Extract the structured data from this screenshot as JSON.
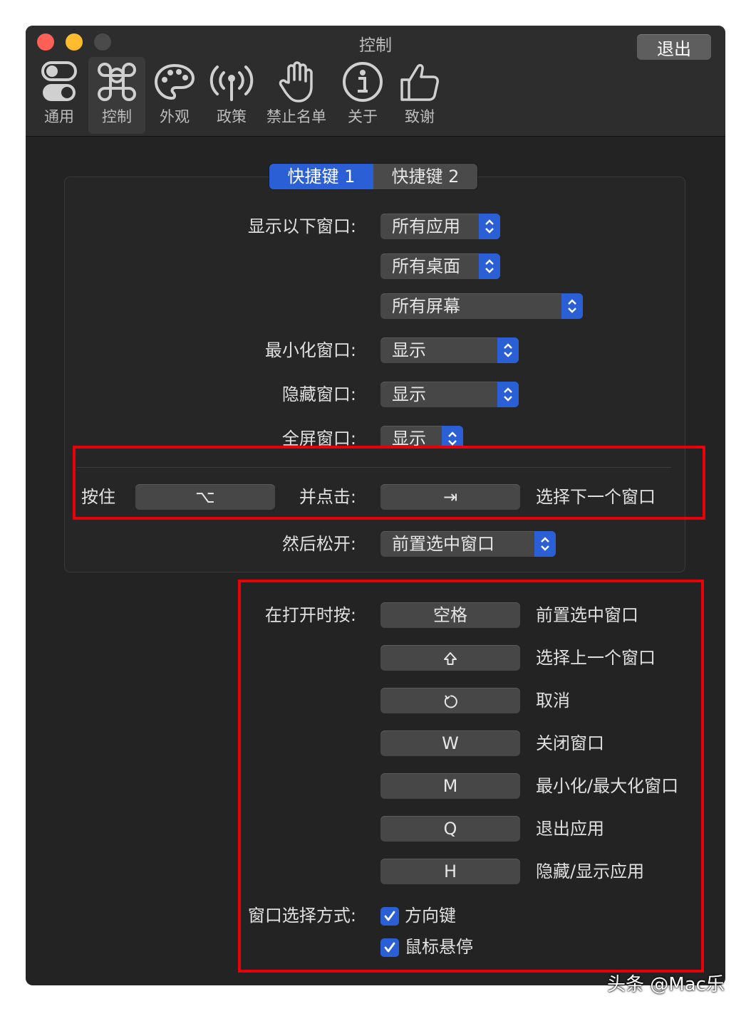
{
  "window": {
    "title": "控制",
    "quit_label": "退出"
  },
  "toolbar": {
    "tabs": [
      {
        "label": "通用",
        "icon": "toggles-icon"
      },
      {
        "label": "控制",
        "icon": "command-icon"
      },
      {
        "label": "外观",
        "icon": "palette-icon"
      },
      {
        "label": "政策",
        "icon": "antenna-icon"
      },
      {
        "label": "禁止名单",
        "icon": "hand-icon"
      },
      {
        "label": "关于",
        "icon": "info-icon"
      },
      {
        "label": "致谢",
        "icon": "thumbs-up-icon"
      }
    ],
    "selected": "控制"
  },
  "shortcut_tabs": {
    "tab1": "快捷键 1",
    "tab2": "快捷键 2",
    "selected": "快捷键 1"
  },
  "settings": {
    "show_windows_label": "显示以下窗口:",
    "show_apps_value": "所有应用",
    "show_desktops_value": "所有桌面",
    "show_screens_value": "所有屏幕",
    "minimized_label": "最小化窗口:",
    "minimized_value": "显示",
    "hidden_label": "隐藏窗口:",
    "hidden_value": "显示",
    "fullscreen_label": "全屏窗口:",
    "fullscreen_value": "显示",
    "hold_label": "按住",
    "hold_key": "⌥",
    "and_press_label": "并点击:",
    "press_key": "⇥",
    "press_action": "选择下一个窗口",
    "release_label": "然后松开:",
    "release_value": "前置选中窗口"
  },
  "while_open": {
    "label": "在打开时按:",
    "rows": [
      {
        "key": "空格",
        "action": "前置选中窗口",
        "key_icon": ""
      },
      {
        "key": "",
        "action": "选择上一个窗口",
        "key_icon": "shift-icon"
      },
      {
        "key": "",
        "action": "取消",
        "key_icon": "undo-icon"
      },
      {
        "key": "W",
        "action": "关闭窗口",
        "key_icon": ""
      },
      {
        "key": "M",
        "action": "最小化/最大化窗口",
        "key_icon": ""
      },
      {
        "key": "Q",
        "action": "退出应用",
        "key_icon": ""
      },
      {
        "key": "H",
        "action": "隐藏/显示应用",
        "key_icon": ""
      }
    ],
    "selection_label": "窗口选择方式:",
    "arrow_keys_label": "方向键",
    "arrow_keys_checked": true,
    "mouse_hover_label": "鼠标悬停",
    "mouse_hover_checked": true
  },
  "colors": {
    "accent": "#2a5fd6",
    "highlight_box": "#e8000b",
    "window_bg": "#232323"
  },
  "watermark": "头条 @Mac乐"
}
